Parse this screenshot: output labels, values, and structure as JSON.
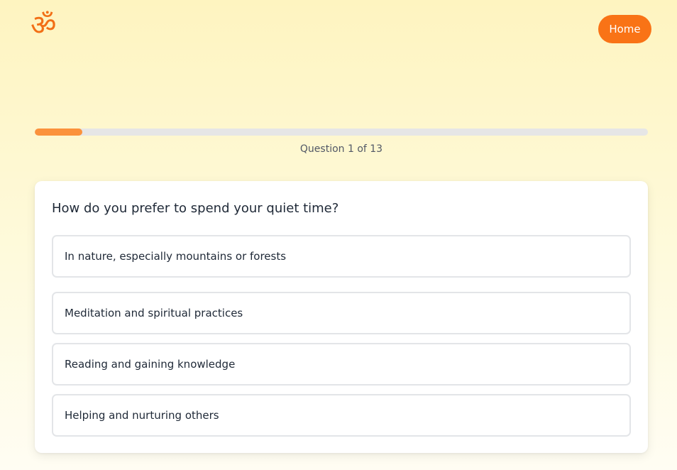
{
  "header": {
    "logo_glyph": "ॐ",
    "home_label": "Home"
  },
  "progress": {
    "current": 1,
    "total": 13,
    "fraction": 0.077,
    "label": "Question 1 of 13"
  },
  "quiz": {
    "question": "How do you prefer to spend your quiet time?",
    "options": [
      "In nature, especially mountains or forests",
      "Meditation and spiritual practices",
      "Reading and gaining knowledge",
      "Helping and nurturing others"
    ]
  },
  "colors": {
    "accent": "#f97316",
    "progress_fill": "#fb923c",
    "background_top": "#fef4c0"
  }
}
